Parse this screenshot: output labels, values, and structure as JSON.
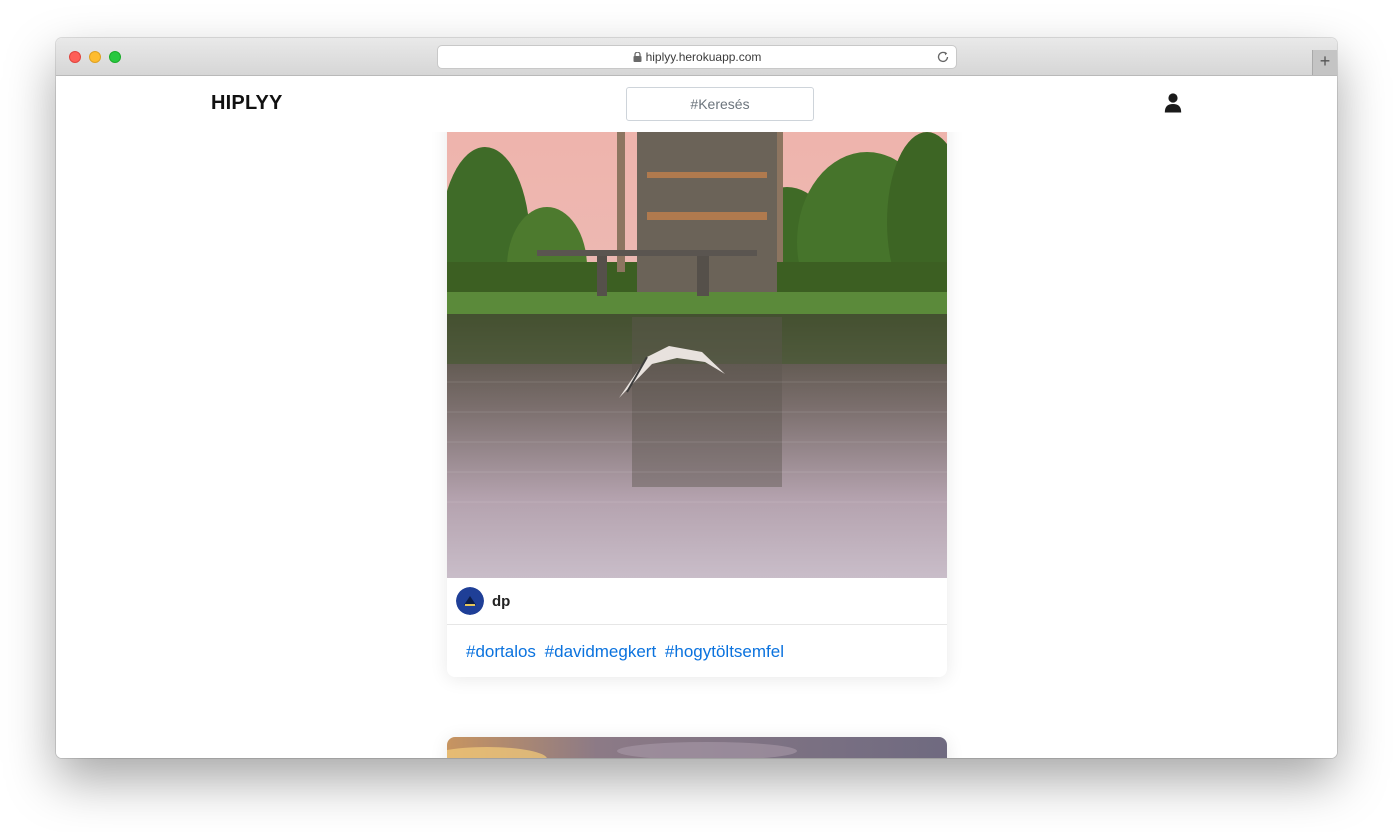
{
  "browser": {
    "url": "hiplyy.herokuapp.com"
  },
  "navbar": {
    "brand": "HIPLYY",
    "search_placeholder": "#Keresés"
  },
  "post": {
    "author": "dp",
    "tags": [
      "#dortalos",
      "#davidmegkert",
      "#hogytöltsemfel"
    ]
  },
  "colors": {
    "link": "#0a72de",
    "avatar": "#1f3f97"
  },
  "icons": {
    "lock": "lock-icon",
    "reload": "reload-icon",
    "user": "user-icon",
    "new_tab": "plus-icon"
  }
}
